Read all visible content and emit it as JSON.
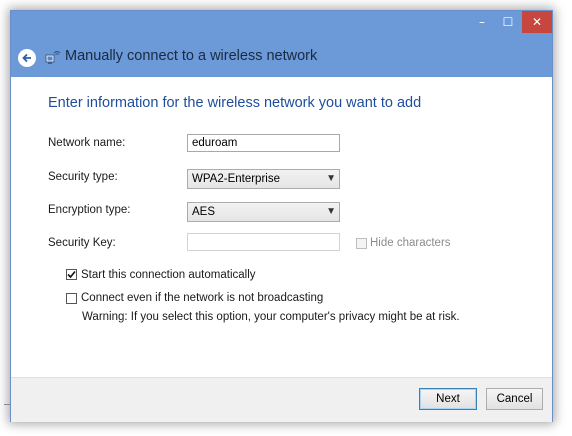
{
  "window": {
    "title": "Manually connect to a wireless network",
    "controls": {
      "minimize": "–",
      "maximize": "☐",
      "close": "✕"
    }
  },
  "heading": "Enter information for the wireless network you want to add",
  "form": {
    "network_name": {
      "label": "Network name:",
      "value": "eduroam"
    },
    "security_type": {
      "label": "Security type:",
      "value": "WPA2-Enterprise"
    },
    "encryption_type": {
      "label": "Encryption type:",
      "value": "AES"
    },
    "security_key": {
      "label": "Security Key:",
      "value": "",
      "hide_characters_label": "Hide characters",
      "hide_characters_checked": false
    }
  },
  "options": {
    "start_auto": {
      "label": "Start this connection automatically",
      "checked": true
    },
    "connect_even": {
      "label": "Connect even if the network is not broadcasting",
      "checked": false
    },
    "warning": "Warning: If you select this option, your computer's privacy might be at risk."
  },
  "buttons": {
    "next": "Next",
    "cancel": "Cancel"
  },
  "colors": {
    "titlebar": "#6c99d8",
    "heading": "#1e4d9e",
    "close": "#c7463d"
  }
}
